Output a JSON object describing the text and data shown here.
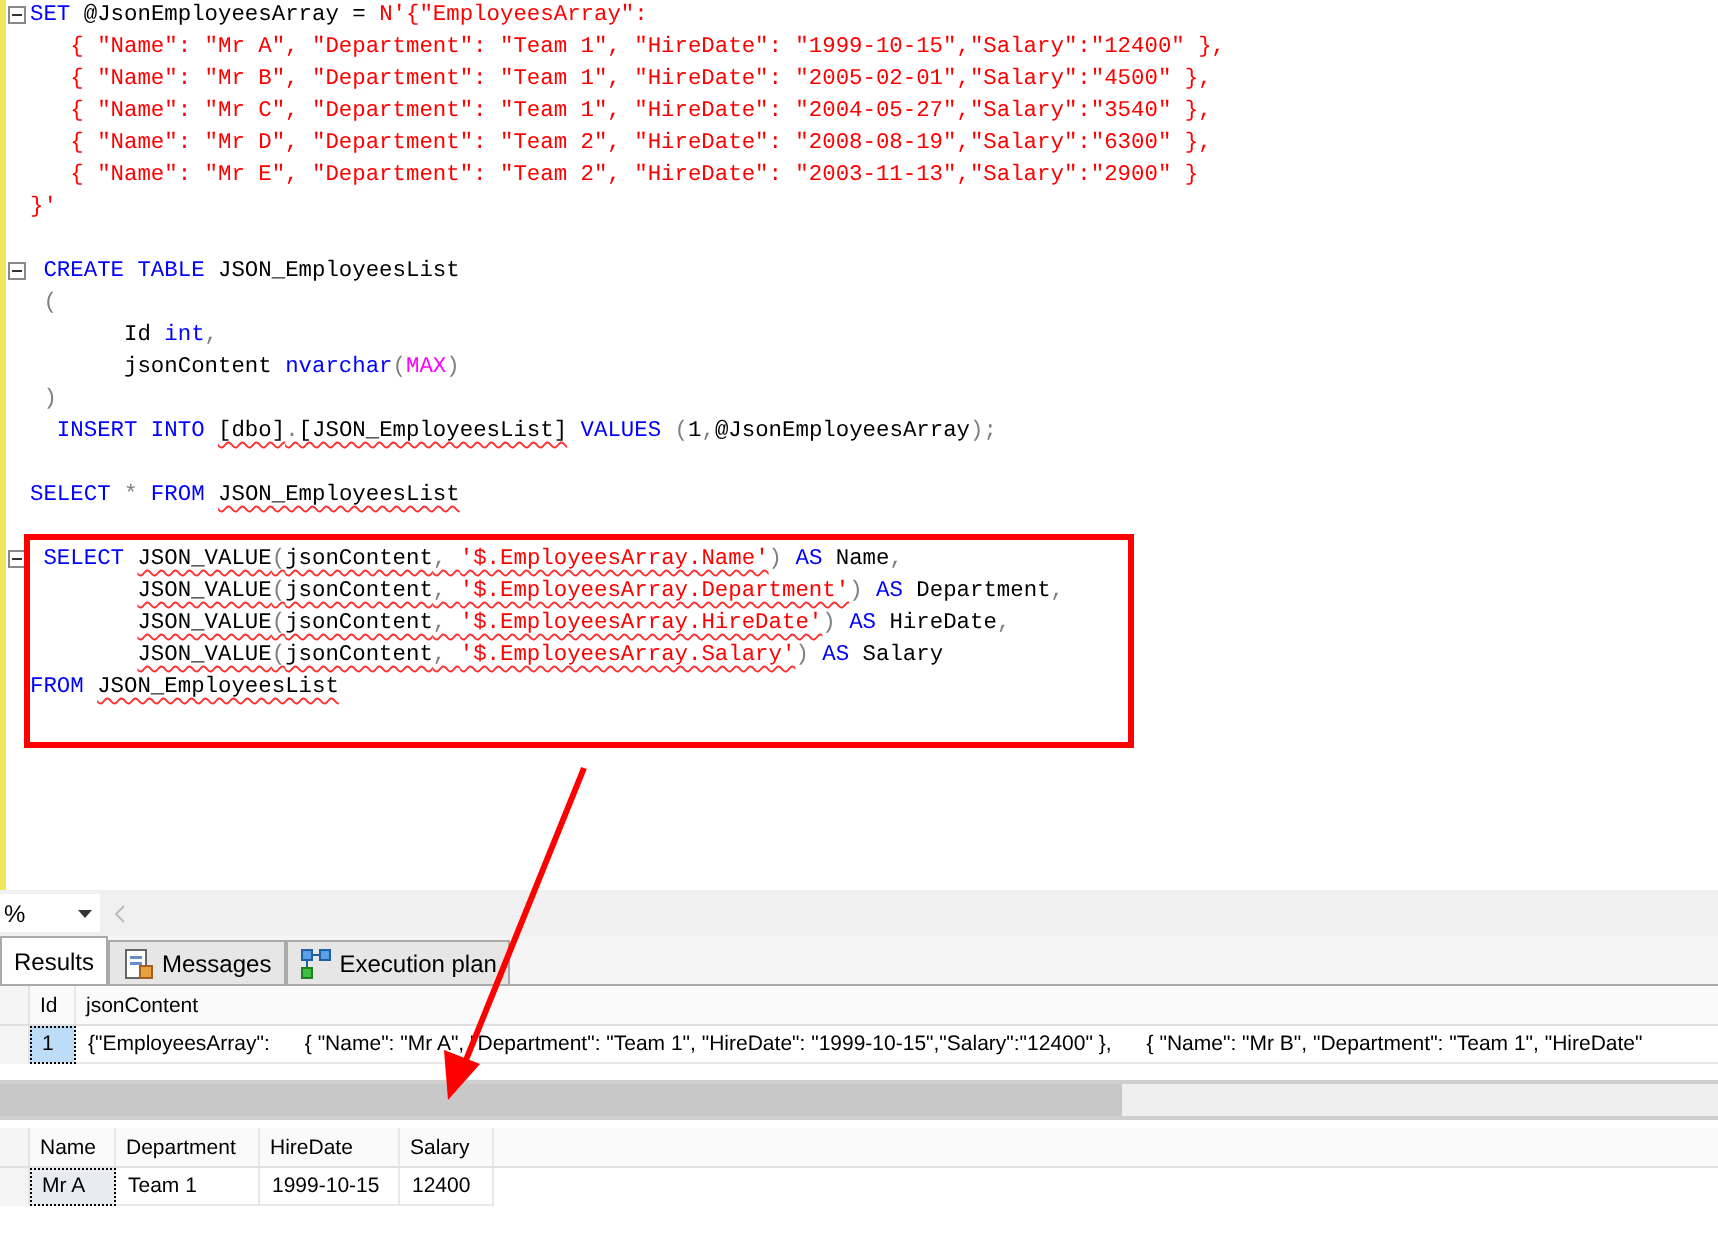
{
  "code_lines": [
    {
      "collapsible": true,
      "tokens": [
        {
          "text": "SET",
          "kind": "keyword",
          "error": false
        },
        {
          "text": " @JsonEmployeesArray = ",
          "kind": "plain",
          "error": false
        },
        {
          "text": "N'{\"EmployeesArray\":",
          "kind": "string",
          "error": false
        }
      ]
    },
    {
      "collapsible": false,
      "tokens": [
        {
          "text": "   { \"Name\": \"Mr A\", \"Department\": \"Team 1\", \"HireDate\": \"1999-10-15\",\"Salary\":\"12400\" },",
          "kind": "string",
          "error": false
        }
      ]
    },
    {
      "collapsible": false,
      "tokens": [
        {
          "text": "   { \"Name\": \"Mr B\", \"Department\": \"Team 1\", \"HireDate\": \"2005-02-01\",\"Salary\":\"4500\" },",
          "kind": "string",
          "error": false
        }
      ]
    },
    {
      "collapsible": false,
      "tokens": [
        {
          "text": "   { \"Name\": \"Mr C\", \"Department\": \"Team 1\", \"HireDate\": \"2004-05-27\",\"Salary\":\"3540\" },",
          "kind": "string",
          "error": false
        }
      ]
    },
    {
      "collapsible": false,
      "tokens": [
        {
          "text": "   { \"Name\": \"Mr D\", \"Department\": \"Team 2\", \"HireDate\": \"2008-08-19\",\"Salary\":\"6300\" },",
          "kind": "string",
          "error": false
        }
      ]
    },
    {
      "collapsible": false,
      "tokens": [
        {
          "text": "   { \"Name\": \"Mr E\", \"Department\": \"Team 2\", \"HireDate\": \"2003-11-13\",\"Salary\":\"2900\" }",
          "kind": "string",
          "error": false
        }
      ]
    },
    {
      "collapsible": false,
      "tokens": [
        {
          "text": "}'",
          "kind": "string",
          "error": false
        }
      ]
    },
    {
      "collapsible": false
    },
    {
      "collapsible": true,
      "tokens": [
        {
          "text": " CREATE TABLE",
          "kind": "keyword",
          "error": false
        },
        {
          "text": " JSON_EmployeesList",
          "kind": "plain",
          "error": false
        }
      ]
    },
    {
      "collapsible": false,
      "tokens": [
        {
          "text": " (",
          "kind": "operator",
          "error": false
        }
      ]
    },
    {
      "collapsible": false,
      "tokens": [
        {
          "text": "       Id ",
          "kind": "plain",
          "error": false
        },
        {
          "text": "int",
          "kind": "keyword",
          "error": false
        },
        {
          "text": ",",
          "kind": "operator",
          "error": false
        }
      ]
    },
    {
      "collapsible": false,
      "tokens": [
        {
          "text": "       jsonContent ",
          "kind": "plain",
          "error": false
        },
        {
          "text": "nvarchar",
          "kind": "keyword",
          "error": false
        },
        {
          "text": "(",
          "kind": "operator",
          "error": false
        },
        {
          "text": "MAX",
          "kind": "function",
          "error": false
        },
        {
          "text": ")",
          "kind": "operator",
          "error": false
        }
      ]
    },
    {
      "collapsible": false,
      "tokens": [
        {
          "text": " )",
          "kind": "operator",
          "error": false
        }
      ]
    },
    {
      "collapsible": false,
      "tokens": [
        {
          "text": "  INSERT INTO ",
          "kind": "keyword",
          "error": false
        },
        {
          "text": "[dbo]",
          "kind": "plain",
          "error": true
        },
        {
          "text": ".",
          "kind": "operator",
          "error": true
        },
        {
          "text": "[JSON_EmployeesList]",
          "kind": "plain",
          "error": true
        },
        {
          "text": " VALUES ",
          "kind": "keyword",
          "error": false
        },
        {
          "text": "(",
          "kind": "operator",
          "error": false
        },
        {
          "text": "1",
          "kind": "plain",
          "error": false
        },
        {
          "text": ",",
          "kind": "operator",
          "error": false
        },
        {
          "text": "@JsonEmployeesArray",
          "kind": "plain",
          "error": false
        },
        {
          "text": ");",
          "kind": "operator",
          "error": false
        }
      ]
    },
    {
      "collapsible": false
    },
    {
      "collapsible": false,
      "tokens": [
        {
          "text": "SELECT ",
          "kind": "keyword",
          "error": false
        },
        {
          "text": "*",
          "kind": "operator",
          "error": false
        },
        {
          "text": " FROM ",
          "kind": "keyword",
          "error": false
        },
        {
          "text": "JSON_EmployeesList",
          "kind": "plain",
          "error": true
        }
      ]
    },
    {
      "collapsible": false
    },
    {
      "collapsible": true,
      "tokens": [
        {
          "text": " SELECT ",
          "kind": "keyword",
          "error": false
        },
        {
          "text": "JSON_VALUE",
          "kind": "plain",
          "error": true
        },
        {
          "text": "(",
          "kind": "operator",
          "error": true
        },
        {
          "text": "jsonContent",
          "kind": "plain",
          "error": true
        },
        {
          "text": ", ",
          "kind": "operator",
          "error": true
        },
        {
          "text": "'$.EmployeesArray.Name'",
          "kind": "string",
          "error": true
        },
        {
          "text": ")",
          "kind": "operator",
          "error": false
        },
        {
          "text": " AS ",
          "kind": "keyword",
          "error": false
        },
        {
          "text": "Name",
          "kind": "plain",
          "error": false
        },
        {
          "text": ",",
          "kind": "operator",
          "error": false
        }
      ]
    },
    {
      "collapsible": false,
      "kind": "continuation",
      "tokens": [
        {
          "text": "JSON_VALUE",
          "kind": "plain",
          "error": true
        },
        {
          "text": "(",
          "kind": "operator",
          "error": true
        },
        {
          "text": "jsonContent",
          "kind": "plain",
          "error": true
        },
        {
          "text": ", ",
          "kind": "operator",
          "error": true
        },
        {
          "text": "'$.EmployeesArray.Department'",
          "kind": "string",
          "error": true
        },
        {
          "text": ")",
          "kind": "operator",
          "error": false
        },
        {
          "text": " AS ",
          "kind": "keyword",
          "error": false
        },
        {
          "text": "Department",
          "kind": "plain",
          "error": false
        },
        {
          "text": ",",
          "kind": "operator",
          "error": false
        }
      ]
    },
    {
      "collapsible": false,
      "kind": "continuation",
      "tokens": [
        {
          "text": "JSON_VALUE",
          "kind": "plain",
          "error": true
        },
        {
          "text": "(",
          "kind": "operator",
          "error": true
        },
        {
          "text": "jsonContent",
          "kind": "plain",
          "error": true
        },
        {
          "text": ", ",
          "kind": "operator",
          "error": true
        },
        {
          "text": "'$.EmployeesArray.HireDate'",
          "kind": "string",
          "error": true
        },
        {
          "text": ")",
          "kind": "operator",
          "error": false
        },
        {
          "text": " AS ",
          "kind": "keyword",
          "error": false
        },
        {
          "text": "HireDate",
          "kind": "plain",
          "error": false
        },
        {
          "text": ",",
          "kind": "operator",
          "error": false
        }
      ]
    },
    {
      "collapsible": false,
      "kind": "continuation",
      "tokens": [
        {
          "text": "JSON_VALUE",
          "kind": "plain",
          "error": true
        },
        {
          "text": "(",
          "kind": "operator",
          "error": true
        },
        {
          "text": "jsonContent",
          "kind": "plain",
          "error": true
        },
        {
          "text": ", ",
          "kind": "operator",
          "error": true
        },
        {
          "text": "'$.EmployeesArray.Salary'",
          "kind": "string",
          "error": true
        },
        {
          "text": ")",
          "kind": "operator",
          "error": false
        },
        {
          "text": " AS ",
          "kind": "keyword",
          "error": false
        },
        {
          "text": "Salary",
          "kind": "plain",
          "error": false
        }
      ]
    },
    {
      "collapsible": false,
      "tokens": [
        {
          "text": "FROM ",
          "kind": "keyword",
          "error": false
        },
        {
          "text": "JSON_EmployeesList",
          "kind": "plain",
          "error": true
        }
      ]
    }
  ],
  "zoom": {
    "value": "%"
  },
  "tabs": [
    {
      "label": "Results",
      "kind": "grid",
      "selected": true
    },
    {
      "label": "Messages",
      "kind": "messages",
      "selected": false
    },
    {
      "label": "Execution plan",
      "kind": "plan",
      "selected": false
    }
  ],
  "grids": [
    {
      "columns": [
        "Id",
        "jsonContent"
      ],
      "rows": [
        [
          {
            "text": "1",
            "selected": true
          },
          {
            "text": "{\"EmployeesArray\":      { \"Name\": \"Mr A\", \"Department\": \"Team 1\", \"HireDate\": \"1999-10-15\",\"Salary\":\"12400\" },      { \"Name\": \"Mr B\", \"Department\": \"Team 1\", \"HireDate\"",
            "selected": false
          }
        ]
      ]
    },
    {
      "columns": [
        "Name",
        "Department",
        "HireDate",
        "Salary"
      ],
      "rows": [
        [
          {
            "text": "Mr A",
            "selected": true
          },
          {
            "text": "Team 1",
            "selected": false
          },
          {
            "text": "1999-10-15",
            "selected": false
          },
          {
            "text": "12400",
            "selected": false
          }
        ]
      ]
    }
  ]
}
